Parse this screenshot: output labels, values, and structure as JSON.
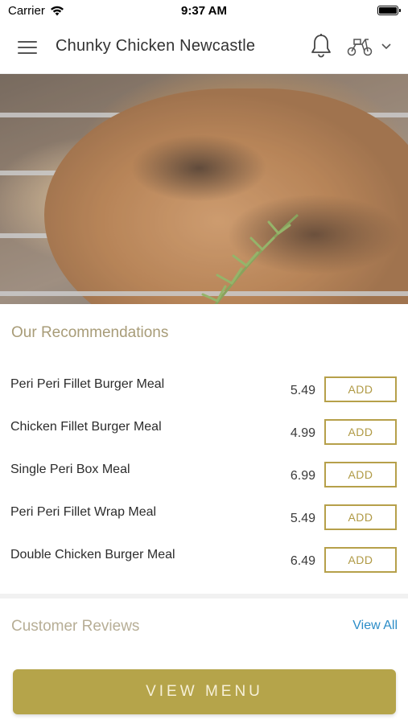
{
  "status_bar": {
    "carrier": "Carrier",
    "time": "9:37 AM"
  },
  "header": {
    "title": "Chunky Chicken Newcastle"
  },
  "icons": {
    "menu": "hamburger-menu-icon",
    "notifications": "bell-icon",
    "delivery": "scooter-icon",
    "dropdown": "chevron-down-icon",
    "wifi": "wifi-icon",
    "battery": "battery-icon"
  },
  "colors": {
    "accent": "#b5a44a",
    "link": "#2b8cc7",
    "section_title": "#a89c78"
  },
  "recommendations": {
    "title": "Our Recommendations",
    "items": [
      {
        "name": "Peri Peri Fillet Burger Meal",
        "price": "5.49",
        "action": "ADD"
      },
      {
        "name": "Chicken Fillet Burger Meal",
        "price": "4.99",
        "action": "ADD"
      },
      {
        "name": "Single Peri Box Meal",
        "price": "6.99",
        "action": "ADD"
      },
      {
        "name": "Peri Peri Fillet Wrap Meal",
        "price": "5.49",
        "action": "ADD"
      },
      {
        "name": "Double Chicken Burger Meal",
        "price": "6.49",
        "action": "ADD"
      }
    ]
  },
  "reviews": {
    "title": "Customer Reviews",
    "view_all": "View All"
  },
  "footer": {
    "view_menu": "VIEW MENU"
  }
}
